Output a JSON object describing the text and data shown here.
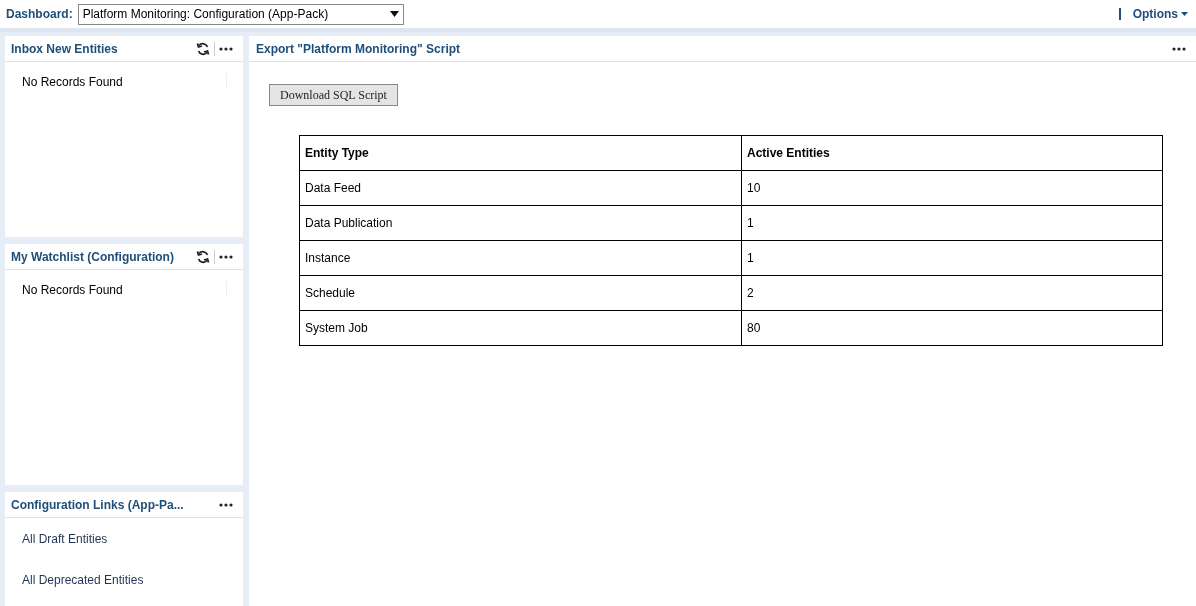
{
  "top_bar": {
    "dashboard_label": "Dashboard:",
    "dashboard_select": "Platform Monitoring: Configuration (App-Pack)",
    "options": "Options"
  },
  "side_panels": [
    {
      "title": "Inbox New Entities",
      "refresh": true,
      "kind": "records",
      "message": "No Records Found"
    },
    {
      "title": "My Watchlist (Configuration)",
      "refresh": true,
      "kind": "records",
      "message": "No Records Found"
    },
    {
      "title": "Configuration Links (App-Pa...",
      "refresh": false,
      "kind": "links",
      "links": [
        "All Draft Entities",
        "All Deprecated Entities"
      ]
    }
  ],
  "main_panel": {
    "title": "Export \"Platform Monitoring\" Script",
    "button": "Download SQL Script",
    "table": {
      "columns": [
        "Entity Type",
        "Active Entities"
      ],
      "rows": [
        [
          "Data Feed",
          "10"
        ],
        [
          "Data Publication",
          "1"
        ],
        [
          "Instance",
          "1"
        ],
        [
          "Schedule",
          "2"
        ],
        [
          "System Job",
          "80"
        ]
      ]
    }
  }
}
